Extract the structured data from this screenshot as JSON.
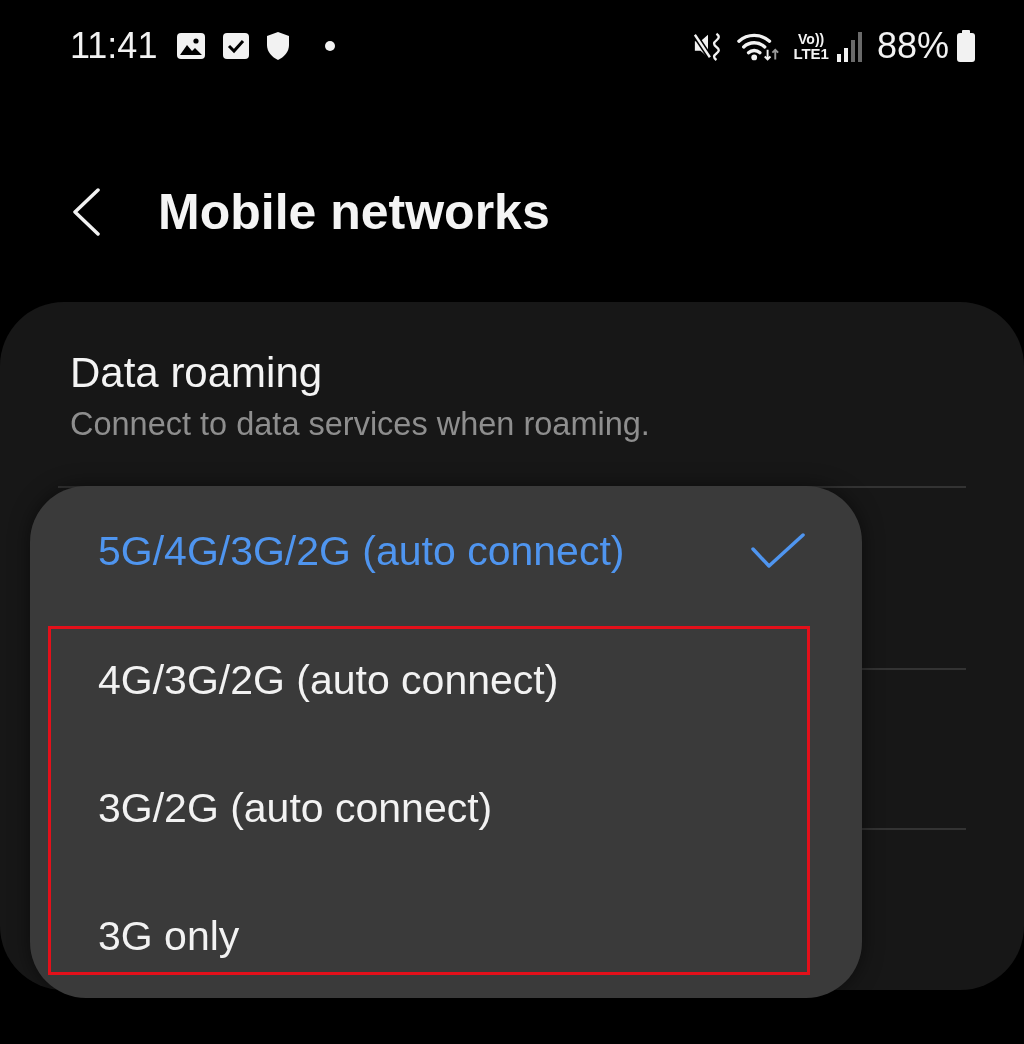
{
  "status_bar": {
    "time": "11:41",
    "volte": "Vo))",
    "network": "LTE1",
    "battery": "88%"
  },
  "header": {
    "title": "Mobile networks"
  },
  "settings": [
    {
      "title": "Data roaming",
      "subtitle": "Connect to data services when roaming."
    }
  ],
  "network_mode_menu": {
    "options": [
      {
        "label": "5G/4G/3G/2G (auto connect)",
        "selected": true,
        "highlighted": false
      },
      {
        "label": "4G/3G/2G (auto connect)",
        "selected": false,
        "highlighted": true
      },
      {
        "label": "3G/2G (auto connect)",
        "selected": false,
        "highlighted": true
      },
      {
        "label": "3G only",
        "selected": false,
        "highlighted": true
      }
    ]
  }
}
